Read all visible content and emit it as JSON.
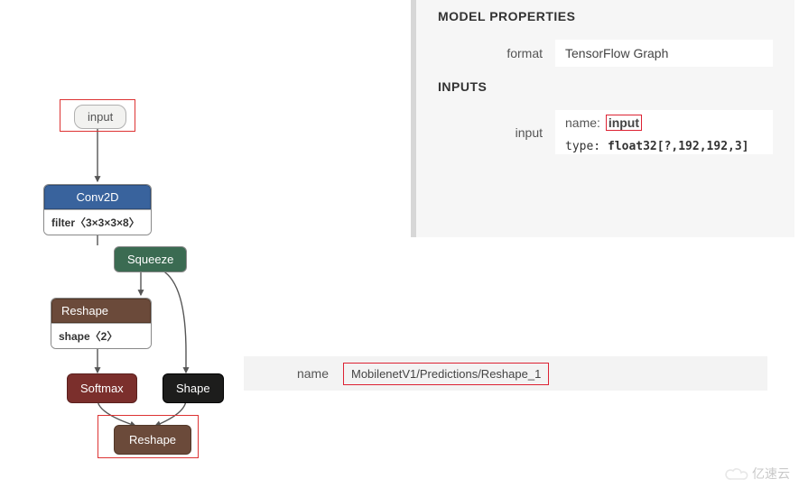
{
  "graph": {
    "input": {
      "label": "input"
    },
    "conv2d": {
      "label": "Conv2D",
      "filter": "filter〈3×3×3×8〉"
    },
    "squeeze": {
      "label": "Squeeze"
    },
    "reshape_a": {
      "label": "Reshape",
      "shape": "shape〈2〉"
    },
    "softmax": {
      "label": "Softmax"
    },
    "shape": {
      "label": "Shape"
    },
    "reshape_b": {
      "label": "Reshape"
    }
  },
  "properties": {
    "heading": "MODEL PROPERTIES",
    "format_label": "format",
    "format_value": "TensorFlow Graph",
    "inputs_heading": "INPUTS",
    "input_label": "input",
    "name_key": "name:",
    "name_value": "input",
    "type_key": "type:",
    "type_value": "float32[?,192,192,3]"
  },
  "output_row": {
    "label": "name",
    "value": "MobilenetV1/Predictions/Reshape_1"
  },
  "watermark": "亿速云"
}
